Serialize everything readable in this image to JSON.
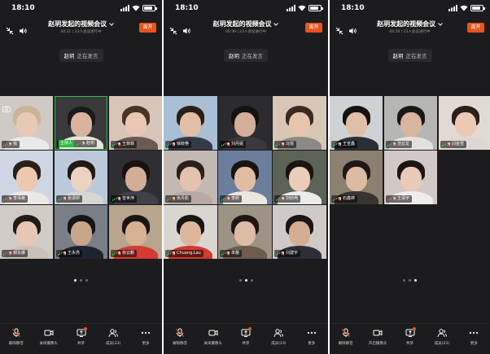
{
  "panels": [
    {
      "status": {
        "time": "18:10"
      },
      "title": "赵玥发起的视频会议",
      "subtitle": "00:21 | 23人会议进行中",
      "leave_label": "离开",
      "speaking_name": "赵玥",
      "speaking_status": "正在发言",
      "tiles": [
        {
          "name": "我",
          "camera_icon": true,
          "bg": "#cfcac4",
          "skin": "#e7c9b5",
          "hair": "#c8b59a",
          "shirt": "#e9e9ea"
        },
        {
          "name": "赵玥",
          "host": "主持人",
          "active": true,
          "bg": "#3a3a3c",
          "skin": "#d9b39c",
          "hair": "#1a1a1a",
          "shirt": "#e8e4de"
        },
        {
          "name": "王菲菲",
          "bg": "#d6c5b8",
          "skin": "#e9c7b2",
          "hair": "#4a3328",
          "shirt": "#6b5a52"
        },
        {
          "name": "李泽薇",
          "bg": "#cfd6e3",
          "skin": "#ecc8b0",
          "hair": "#2a1f1a",
          "shirt": "#ece8e6"
        },
        {
          "name": "张潇妍",
          "bg": "#bcc9dd",
          "skin": "#ecd2c1",
          "hair": "#231915",
          "shirt": "#d8d5d4"
        },
        {
          "name": "曾世萍",
          "bg": "#2e2e33",
          "skin": "#d2ae98",
          "hair": "#18120f",
          "shirt": "#40404a"
        },
        {
          "name": "郝永娜",
          "bg": "#d1cbc6",
          "skin": "#e6c7b4",
          "hair": "#231915",
          "shirt": "#c9c0b8"
        },
        {
          "name": "王永亮",
          "bg": "#7a7e86",
          "skin": "#c9a58c",
          "hair": "#151515",
          "shirt": "#1e2430"
        },
        {
          "name": "余云鹏",
          "bg": "#b8a58e",
          "skin": "#d6b194",
          "hair": "#1a1512",
          "shirt": "#d63a34"
        }
      ],
      "page_dots": [
        true,
        false,
        false
      ]
    },
    {
      "status": {
        "time": "18:10"
      },
      "title": "赵玥发起的视频会议",
      "subtitle": "00:39 | 23人会议进行中",
      "leave_label": "离开",
      "speaking_name": "赵玥",
      "speaking_status": "正在发言",
      "tiles": [
        {
          "name": "徐晓艳",
          "bg": "#a8bfd4",
          "skin": "#e2bea6",
          "hair": "#2b1f18",
          "shirt": "#353a48"
        },
        {
          "name": "刘丹妮",
          "bg": "#2c2c30",
          "skin": "#d3ae98",
          "hair": "#161210",
          "shirt": "#3a3a3e"
        },
        {
          "name": "马悦",
          "bg": "#d7c7b5",
          "skin": "#e6c4ad",
          "hair": "#3a2a21",
          "shirt": "#8d8a86"
        },
        {
          "name": "张丹影",
          "bg": "#c4b9b2",
          "skin": "#e3c3ae",
          "hair": "#2a1f1a",
          "shirt": "#b9a9a1"
        },
        {
          "name": "李妍",
          "bg": "#6b7f9c",
          "skin": "#e0bca2",
          "hair": "#1a1410",
          "shirt": "#ece7e0"
        },
        {
          "name": "刘欣冉",
          "bg": "#5b6356",
          "skin": "#e8cdb9",
          "hair": "#1a1410",
          "shirt": "#ecebea"
        },
        {
          "name": "Chuang.Lau",
          "bg": "#d9d6d0",
          "skin": "#dcb79d",
          "hair": "#191512",
          "shirt": "#d33a30"
        },
        {
          "name": "单蕾",
          "bg": "#9c9384",
          "skin": "#dcbca8",
          "hair": "#1d1713",
          "shirt": "#6b5c4e"
        },
        {
          "name": "刘建宇",
          "bg": "#cfcac6",
          "skin": "#d4ad92",
          "hair": "#1a1613",
          "shirt": "#2c2f38"
        }
      ],
      "page_dots": [
        false,
        true,
        false
      ]
    },
    {
      "status": {
        "time": "18:10"
      },
      "title": "赵玥发起的视频会议",
      "subtitle": "00:50 | 23人会议进行中",
      "leave_label": "离开",
      "speaking_name": "赵玥",
      "speaking_status": "正在发言",
      "tiles": [
        {
          "name": "王宣鑫",
          "bg": "#cfd2d4",
          "skin": "#dfbfa7",
          "hair": "#161210",
          "shirt": "#2b2e34"
        },
        {
          "name": "范云龙",
          "bg": "#b6b7b4",
          "skin": "#d8b59e",
          "hair": "#1b1715",
          "shirt": "#e4e1dc"
        },
        {
          "name": "闫金雪",
          "bg": "#e0dad2",
          "skin": "#ebcab5",
          "hair": "#2a1f1a",
          "shirt": "#dcd7d1"
        },
        {
          "name": "石鑫婷",
          "bg": "#8c8071",
          "skin": "#dcbba5",
          "hair": "#1f1814",
          "shirt": "#3a3430"
        },
        {
          "name": "王潇宇",
          "bg": "#d2c9c7",
          "skin": "#e8cab8",
          "hair": "#1c1512",
          "shirt": "#f0ecea"
        }
      ],
      "page_dots": [
        false,
        false,
        true
      ]
    }
  ],
  "toolbar": [
    {
      "label": "解除静音",
      "icon": "mic-muted-icon"
    },
    {
      "label": "关闭摄像头",
      "icon": "camera-icon"
    },
    {
      "label": "共享",
      "icon": "share-icon"
    },
    {
      "label": "成员(23)",
      "icon": "members-icon"
    },
    {
      "label": "更多",
      "icon": "more-icon"
    }
  ],
  "toolbar_panel3_camera_label": "开启摄像头",
  "colors": {
    "accent": "#e8541e",
    "active_speaker": "#2fbd47",
    "background": "#1c1c1e"
  }
}
